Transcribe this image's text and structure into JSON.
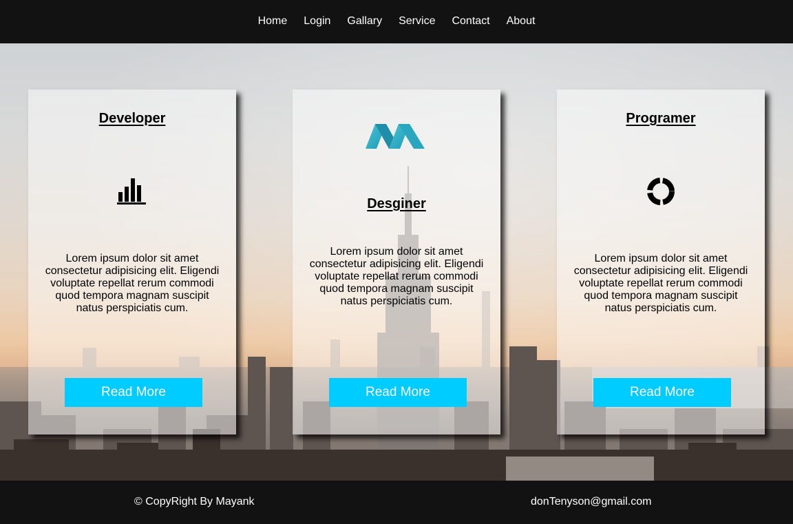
{
  "nav": {
    "items": [
      {
        "label": "Home"
      },
      {
        "label": "Login"
      },
      {
        "label": "Gallary"
      },
      {
        "label": "Service"
      },
      {
        "label": "Contact"
      },
      {
        "label": "About"
      }
    ]
  },
  "cards": [
    {
      "title": "Developer",
      "icon": "bar-chart-icon",
      "text": "Lorem ipsum dolor sit amet consectetur adipisicing elit. Eligendi voluptate repellat rerum commodi quod tempora magnam suscipit natus perspiciatis cum.",
      "button": "Read More"
    },
    {
      "title": "Desginer",
      "icon": "m-logo-icon",
      "text": "Lorem ipsum dolor sit amet consectetur adipisicing elit. Eligendi voluptate repellat rerum commodi quod tempora magnam suscipit natus perspiciatis cum.",
      "button": "Read More"
    },
    {
      "title": "Programer",
      "icon": "loading-ring-icon",
      "text": "Lorem ipsum dolor sit amet consectetur adipisicing elit. Eligendi voluptate repellat rerum commodi quod tempora magnam suscipit natus perspiciatis cum.",
      "button": "Read More"
    }
  ],
  "footer": {
    "copyright": "© CopyRight By Mayank",
    "email": "donTenyson@gmail.com"
  },
  "colors": {
    "nav_bg": "#121212",
    "accent": "#00ccff",
    "logo_teal": "#2fb3c8"
  }
}
